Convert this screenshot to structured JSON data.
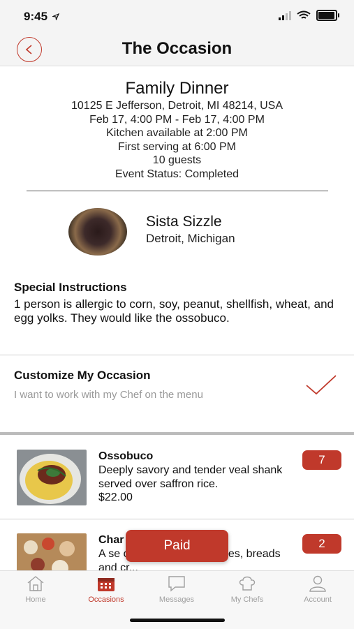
{
  "status_bar": {
    "time": "9:45",
    "location_icon": "location-arrow-icon"
  },
  "header": {
    "title": "The Occasion",
    "back_icon": "chevron-left-icon"
  },
  "event": {
    "title": "Family Dinner",
    "address": "10125 E Jefferson, Detroit, MI 48214, USA",
    "dates": "Feb 17, 4:00 PM - Feb 17, 4:00 PM",
    "kitchen": "Kitchen available at 2:00 PM",
    "serving": "First serving at 6:00 PM",
    "guests": "10 guests",
    "status": "Event Status: Completed"
  },
  "chef": {
    "name": "Sista Sizzle",
    "location": "Detroit, Michigan"
  },
  "special_instructions": {
    "heading": "Special Instructions",
    "body": "1 person is allergic to corn, soy, peanut, shellfish, wheat, and egg yolks. They would like the ossobuco."
  },
  "customize": {
    "heading": "Customize My Occasion",
    "subtitle": "I want to work with my Chef on the menu",
    "checked_icon": "checkmark-icon"
  },
  "menu_items": [
    {
      "name": "Ossobuco",
      "description": "Deeply savory and tender veal shank served over saffron rice.",
      "price": "$22.00",
      "quantity": "7"
    },
    {
      "name": "Char",
      "description": "A se          of local meats, cheeses, breads and cr...",
      "quantity": "2"
    }
  ],
  "paid_button": {
    "label": "Paid"
  },
  "tab_bar": {
    "tabs": [
      {
        "label": "Home",
        "icon": "home-icon"
      },
      {
        "label": "Occasions",
        "icon": "calendar-icon",
        "active": true
      },
      {
        "label": "Messages",
        "icon": "chat-icon"
      },
      {
        "label": "My Chefs",
        "icon": "chef-hat-icon"
      },
      {
        "label": "Account",
        "icon": "person-icon"
      }
    ]
  },
  "colors": {
    "accent": "#c0392b",
    "inactive": "#a0a0a0"
  }
}
